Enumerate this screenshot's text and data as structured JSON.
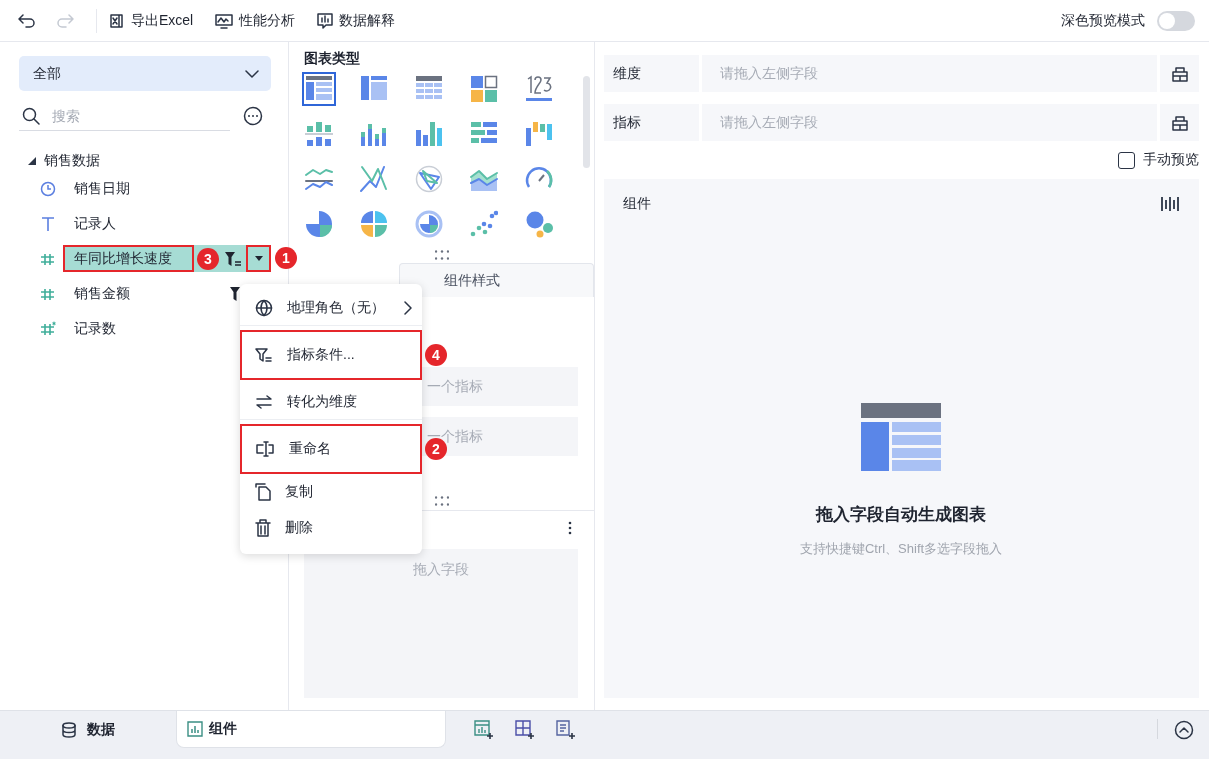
{
  "toolbar": {
    "undo": {
      "disabled": false
    },
    "redo": {
      "disabled": true
    },
    "actions": [
      {
        "label": "导出Excel",
        "kind": "excel"
      },
      {
        "label": "性能分析",
        "kind": "performance"
      },
      {
        "label": "数据解释",
        "kind": "explain"
      }
    ],
    "dark_preview": {
      "label": "深色预览模式",
      "on": false
    }
  },
  "data_panel": {
    "source": "全部",
    "search": {
      "placeholder": "搜索"
    },
    "tree": [
      {
        "label": "销售数据",
        "expanded": true,
        "children": [
          {
            "label": "销售日期",
            "kind": "date",
            "selected": false,
            "filtered": false,
            "highlighted": false
          },
          {
            "label": "记录人",
            "kind": "text",
            "selected": false,
            "filtered": false,
            "highlighted": false
          },
          {
            "label": "年同比增长速度",
            "kind": "number",
            "selected": true,
            "filtered": true,
            "highlighted": true,
            "badge": "3",
            "menu_button": {
              "highlighted": true,
              "badge": "1"
            }
          },
          {
            "label": "销售金额",
            "kind": "number",
            "selected": false,
            "filtered": true,
            "highlighted": false
          },
          {
            "label": "记录数",
            "kind": "count",
            "selected": false,
            "filtered": false,
            "highlighted": false
          }
        ]
      }
    ]
  },
  "chart_types": {
    "title": "图表类型",
    "types": [
      {
        "kind": "table",
        "selected": true
      },
      {
        "kind": "cross-table",
        "selected": false
      },
      {
        "kind": "detail-table",
        "selected": false
      },
      {
        "kind": "kpi",
        "selected": false
      },
      {
        "kind": "number",
        "selected": false
      },
      {
        "kind": "bar-range",
        "selected": false
      },
      {
        "kind": "bar-stacked",
        "selected": false
      },
      {
        "kind": "bar",
        "selected": false
      },
      {
        "kind": "bar-horizontal",
        "selected": false
      },
      {
        "kind": "waterfall",
        "selected": false
      },
      {
        "kind": "line",
        "selected": false
      },
      {
        "kind": "line-cross",
        "selected": false
      },
      {
        "kind": "radar",
        "selected": false
      },
      {
        "kind": "area",
        "selected": false
      },
      {
        "kind": "gauge",
        "selected": false
      },
      {
        "kind": "pie",
        "selected": false
      },
      {
        "kind": "pie-multi",
        "selected": false
      },
      {
        "kind": "donut",
        "selected": false
      },
      {
        "kind": "scatter",
        "selected": false
      },
      {
        "kind": "bubble",
        "selected": false
      }
    ]
  },
  "attribute_tabs": [
    {
      "label": "组件样式",
      "selected": false
    }
  ],
  "metric_slots": [
    {
      "placeholder": "一个指标"
    },
    {
      "placeholder": "一个指标"
    }
  ],
  "field_zone": {
    "placeholder": "拖入字段"
  },
  "context_menu": {
    "items": [
      {
        "label": "地理角色（无）",
        "kind": "globe",
        "submenu": true,
        "separator_after": true,
        "highlighted": false
      },
      {
        "label": "指标条件...",
        "kind": "filter",
        "submenu": false,
        "separator_after": true,
        "highlighted": true,
        "badge": "4"
      },
      {
        "label": "转化为维度",
        "kind": "swap",
        "submenu": false,
        "separator_after": true,
        "highlighted": false
      },
      {
        "label": "重命名",
        "kind": "rename",
        "submenu": false,
        "separator_after": false,
        "highlighted": true,
        "badge": "2"
      },
      {
        "label": "复制",
        "kind": "copy",
        "submenu": false,
        "separator_after": false,
        "highlighted": false
      },
      {
        "label": "删除",
        "kind": "trash",
        "submenu": false,
        "separator_after": false,
        "highlighted": false
      }
    ]
  },
  "shelves": [
    {
      "label": "维度",
      "placeholder": "请拖入左侧字段"
    },
    {
      "label": "指标",
      "placeholder": "请拖入左侧字段"
    }
  ],
  "manual_preview": {
    "label": "手动预览",
    "checked": false
  },
  "canvas": {
    "title": "组件",
    "empty_title": "拖入字段自动生成图表",
    "empty_hint": "支持快捷键Ctrl、Shift多选字段拖入"
  },
  "bottom_tabs": [
    {
      "label": "数据",
      "kind": "data",
      "selected": false
    },
    {
      "label": "组件",
      "kind": "component",
      "selected": true
    }
  ],
  "add_buttons": [
    {
      "kind": "chart"
    },
    {
      "kind": "grid"
    },
    {
      "kind": "report"
    }
  ]
}
